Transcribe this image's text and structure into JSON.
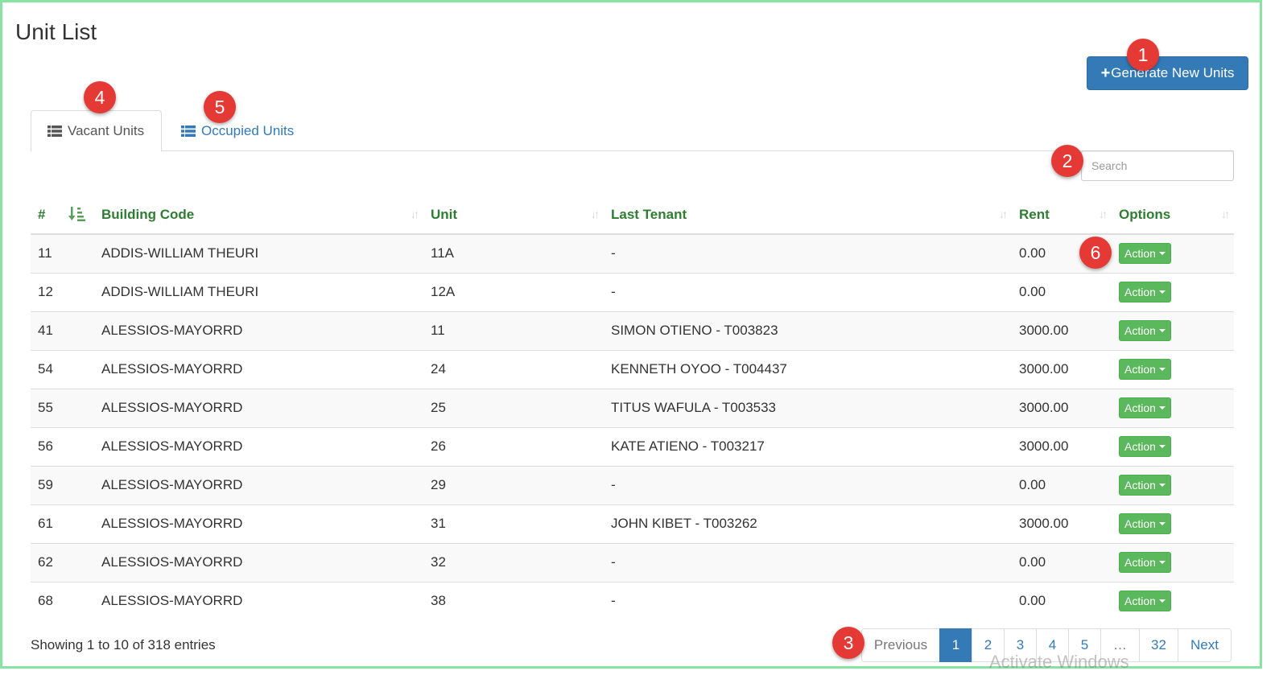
{
  "page": {
    "title": "Unit List"
  },
  "toolbar": {
    "generate_label": "Generate New Units",
    "plus": "+"
  },
  "tabs": [
    {
      "label": "Vacant Units",
      "icon": "list-icon",
      "active": true
    },
    {
      "label": "Occupied Units",
      "icon": "list-icon",
      "active": false
    }
  ],
  "search": {
    "placeholder": "Search",
    "value": ""
  },
  "table": {
    "columns": [
      "#",
      "Building Code",
      "Unit",
      "Last Tenant",
      "Rent",
      "Options"
    ],
    "rows": [
      {
        "id": "11",
        "building": "ADDIS-WILLIAM THEURI",
        "unit": "11A",
        "tenant": "-",
        "rent": "0.00",
        "action": "Action"
      },
      {
        "id": "12",
        "building": "ADDIS-WILLIAM THEURI",
        "unit": "12A",
        "tenant": "-",
        "rent": "0.00",
        "action": "Action"
      },
      {
        "id": "41",
        "building": "ALESSIOS-MAYORRD",
        "unit": "11",
        "tenant": "SIMON OTIENO - T003823",
        "rent": "3000.00",
        "action": "Action"
      },
      {
        "id": "54",
        "building": "ALESSIOS-MAYORRD",
        "unit": "24",
        "tenant": "KENNETH OYOO - T004437",
        "rent": "3000.00",
        "action": "Action"
      },
      {
        "id": "55",
        "building": "ALESSIOS-MAYORRD",
        "unit": "25",
        "tenant": "TITUS WAFULA - T003533",
        "rent": "3000.00",
        "action": "Action"
      },
      {
        "id": "56",
        "building": "ALESSIOS-MAYORRD",
        "unit": "26",
        "tenant": "KATE ATIENO - T003217",
        "rent": "3000.00",
        "action": "Action"
      },
      {
        "id": "59",
        "building": "ALESSIOS-MAYORRD",
        "unit": "29",
        "tenant": "-",
        "rent": "0.00",
        "action": "Action"
      },
      {
        "id": "61",
        "building": "ALESSIOS-MAYORRD",
        "unit": "31",
        "tenant": "JOHN KIBET - T003262",
        "rent": "3000.00",
        "action": "Action"
      },
      {
        "id": "62",
        "building": "ALESSIOS-MAYORRD",
        "unit": "32",
        "tenant": "-",
        "rent": "0.00",
        "action": "Action"
      },
      {
        "id": "68",
        "building": "ALESSIOS-MAYORRD",
        "unit": "38",
        "tenant": "-",
        "rent": "0.00",
        "action": "Action"
      }
    ]
  },
  "footer": {
    "showing": "Showing 1 to 10 of 318 entries"
  },
  "pagination": {
    "previous": "Previous",
    "pages": [
      "1",
      "2",
      "3",
      "4",
      "5"
    ],
    "ellipsis": "…",
    "last": "32",
    "next": "Next",
    "current": "1"
  },
  "callouts": [
    "1",
    "2",
    "3",
    "4",
    "5",
    "6"
  ],
  "watermark": "Activate Windows",
  "colors": {
    "primary": "#337ab7",
    "success": "#5cb85c",
    "header_text": "#2e7d32",
    "callout": "#e53935",
    "frame": "#86e3a1"
  }
}
